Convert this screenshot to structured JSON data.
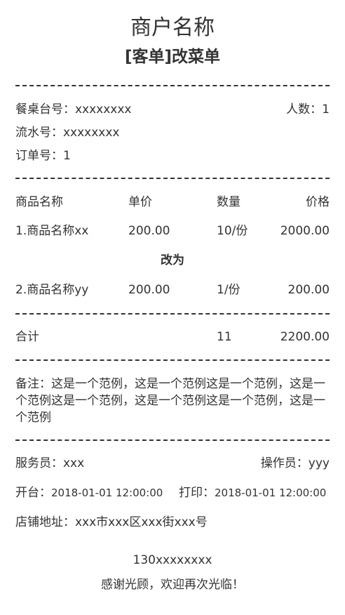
{
  "merchant_name": "商户名称",
  "ticket_type": "[客单]改菜单",
  "table_label": "餐桌台号：xxxxxxxx",
  "guests_label": "人数：1",
  "serial_label": "流水号：xxxxxxxx",
  "order_label": "订单号：1",
  "columns": [
    "商品名称",
    "单价",
    "数量",
    "价格"
  ],
  "items": [
    {
      "name": "1.商品名称xx",
      "price": "200.00",
      "qty": "10/份",
      "total": "2000.00"
    },
    {
      "name": "2.商品名称yy",
      "price": "200.00",
      "qty": "1/份",
      "total": "200.00"
    }
  ],
  "changed_to": "改为",
  "summary": {
    "label": "合计",
    "qty": "11",
    "total": "2200.00"
  },
  "notes": "备注：这是一个范例，这是一个范例这是一个范例，这是一个范例这是一个范例，这是一个范例这是一个范例，这是一个范例",
  "waiter_label": "服务员：xxx",
  "operator_label": "操作员：yyy",
  "open_label": "开台：",
  "open_time": "2018-01-01 12:00:00",
  "print_label": "打印：",
  "print_time": "2018-01-01 12:00:00",
  "address_label": "店铺地址：xxx市xxx区xxx街xxx号",
  "phone": "130xxxxxxxx",
  "thanks": "感谢光顾，欢迎再次光临！"
}
